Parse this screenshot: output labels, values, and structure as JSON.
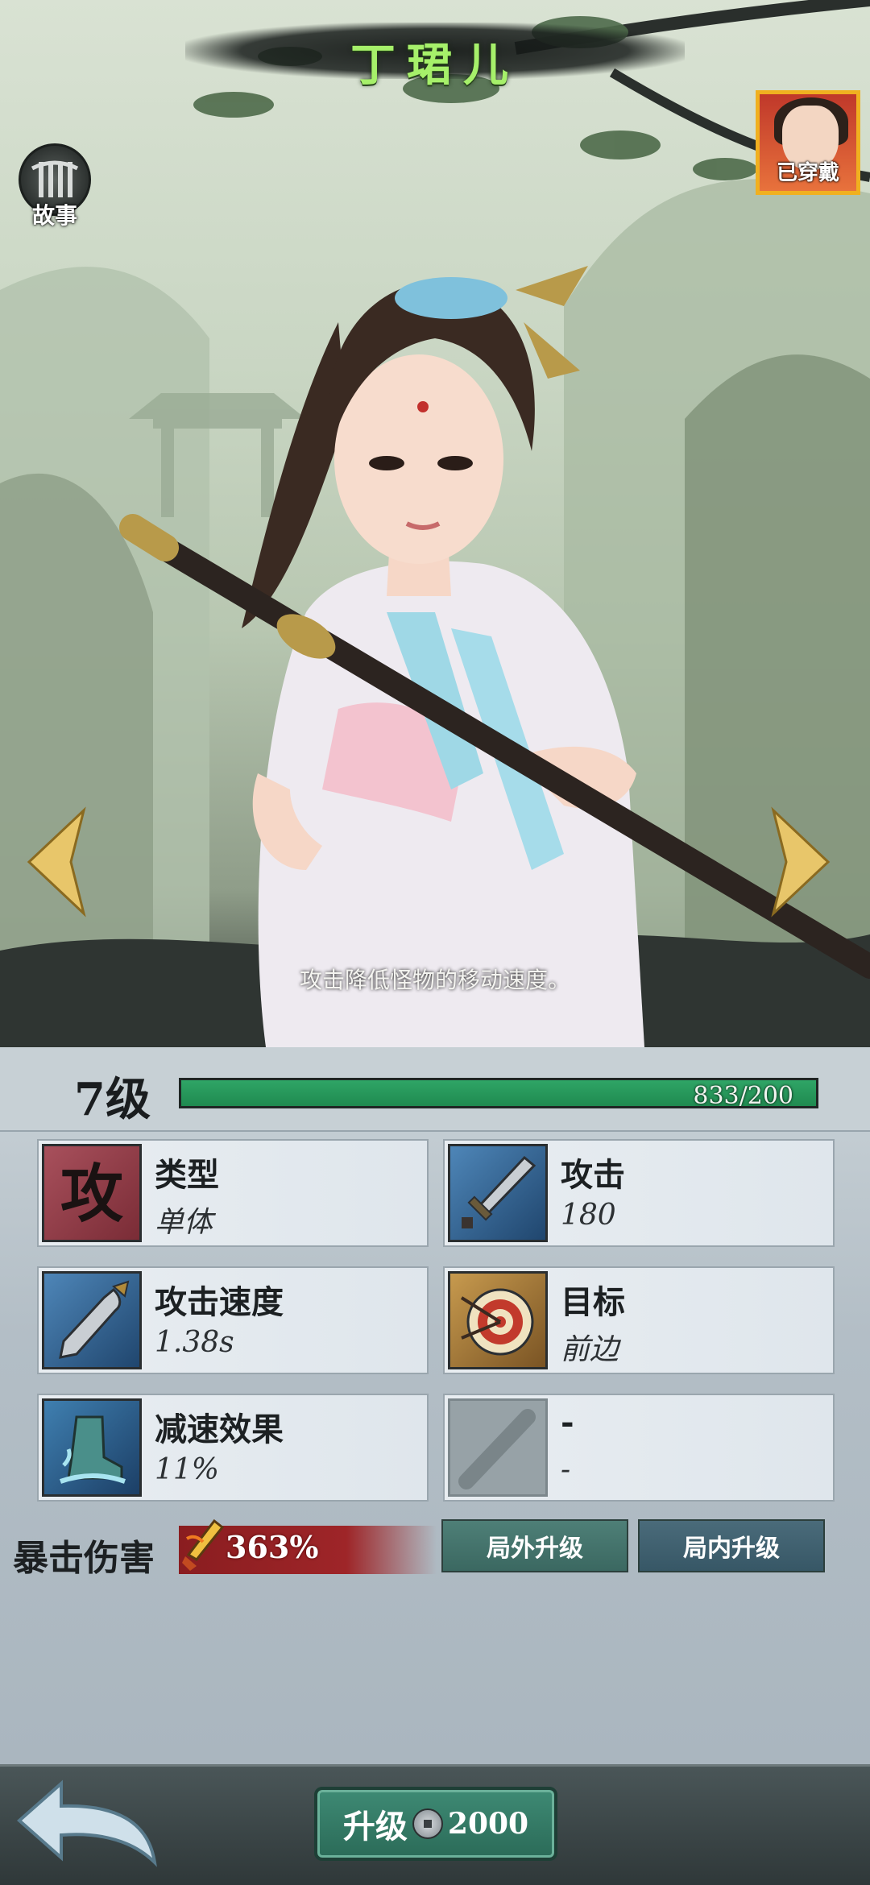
{
  "header": {
    "hero_name": "丁珺儿",
    "story_label": "故事",
    "equipped_label": "已穿戴"
  },
  "hero": {
    "description": "攻击降低怪物的移动速度。"
  },
  "level": {
    "label": "7级",
    "xp_current": 833,
    "xp_max": 200,
    "xp_text": "833/200",
    "xp_fill_fraction": 1.0
  },
  "stats": [
    {
      "title": "类型",
      "value": "单体",
      "icon": "attack-glyph-icon"
    },
    {
      "title": "攻击",
      "value": "180",
      "icon": "sword-icon"
    },
    {
      "title": "攻击速度",
      "value": "1.38s",
      "icon": "dagger-icon"
    },
    {
      "title": "目标",
      "value": "前边",
      "icon": "target-icon"
    },
    {
      "title": "减速效果",
      "value": "11%",
      "icon": "slow-boot-icon"
    },
    {
      "title": "-",
      "value": "-",
      "icon": "empty-slot-icon"
    }
  ],
  "crit": {
    "label": "暴击伤害",
    "value": "363%"
  },
  "buttons": {
    "outer_upgrade": "局外升级",
    "inner_upgrade": "局内升级",
    "upgrade": "升级",
    "upgrade_cost": "2000"
  },
  "colors": {
    "name_green": "#a6f06a",
    "xp_green": "#2fa566",
    "equipped_gold": "#f0b020",
    "crit_red": "#9e2528"
  }
}
